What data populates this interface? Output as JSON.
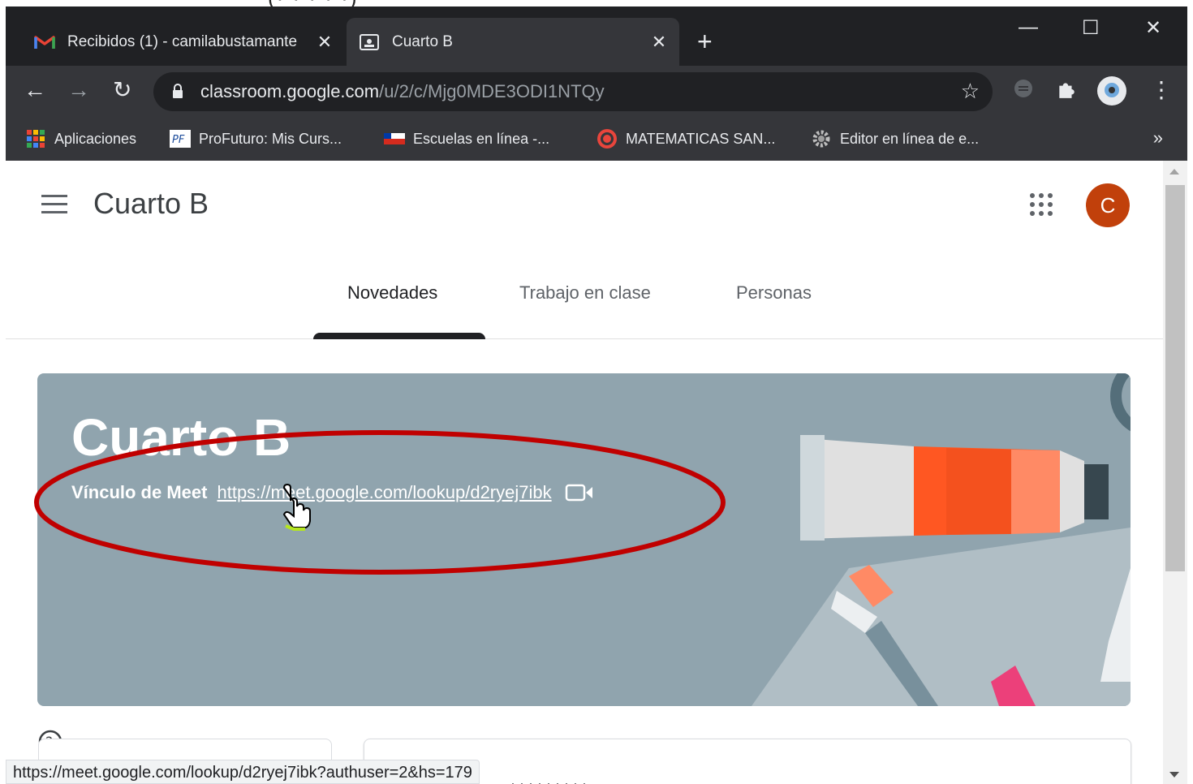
{
  "browser": {
    "tabs": [
      {
        "title": "Recibidos (1) - camilabustamante",
        "icon": "gmail-icon",
        "active": false
      },
      {
        "title": "Cuarto B",
        "icon": "classroom-icon",
        "active": true
      }
    ],
    "address": {
      "host": "classroom.google.com",
      "path": "/u/2/c/Mjg0MDE3ODI1NTQy"
    },
    "bookmarks": [
      {
        "label": "Aplicaciones",
        "icon": "apps-grid-icon"
      },
      {
        "label": "ProFuturo: Mis Curs...",
        "icon": "profuturo-icon"
      },
      {
        "label": "Escuelas en línea -...",
        "icon": "flag-icon"
      },
      {
        "label": "MATEMATICAS SAN...",
        "icon": "target-icon"
      },
      {
        "label": "Editor en línea de e...",
        "icon": "gear-icon"
      }
    ],
    "bookmarks_more": "»",
    "status_url": "https://meet.google.com/lookup/d2ryej7ibk?authuser=2&hs=179"
  },
  "classroom": {
    "title": "Cuarto B",
    "avatar_letter": "C",
    "tabs": [
      {
        "label": "Novedades",
        "selected": true
      },
      {
        "label": "Trabajo en clase",
        "selected": false
      },
      {
        "label": "Personas",
        "selected": false
      }
    ],
    "banner": {
      "title": "Cuarto B",
      "meet_label": "Vínculo de Meet",
      "meet_link": "https://meet.google.com/lookup/d2ryej7ibk"
    }
  },
  "colors": {
    "banner": "#90a4ae",
    "avatar": "#c1400b",
    "annotation": "#c00000"
  }
}
